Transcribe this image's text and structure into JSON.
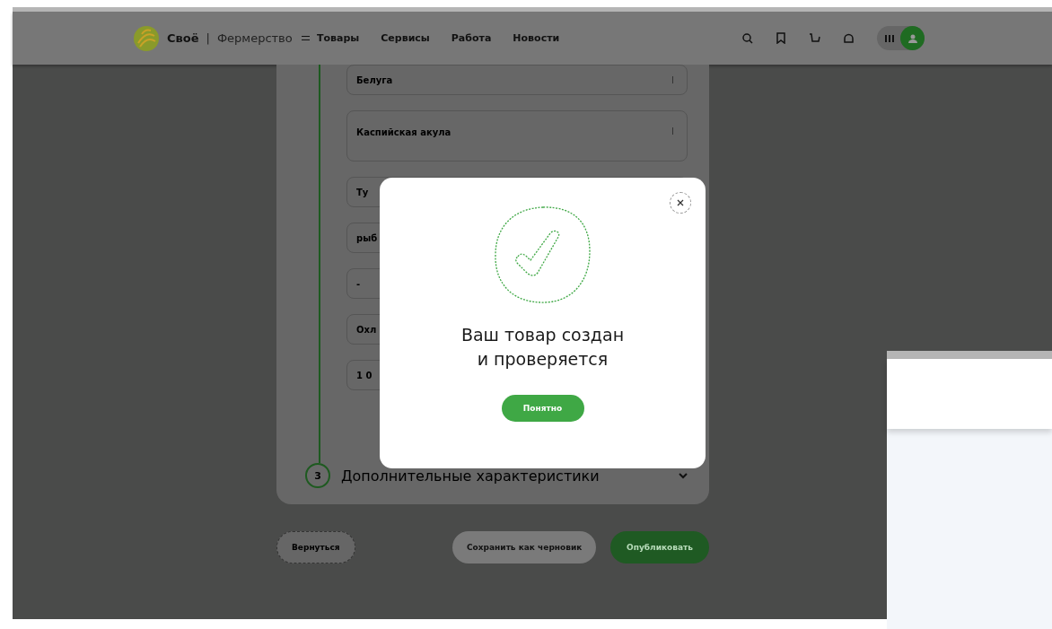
{
  "header": {
    "logo_name": "Своё",
    "logo_separator": "|",
    "logo_title": "Фермерство",
    "nav": [
      {
        "label": "Товары",
        "kind": "menu"
      },
      {
        "label": "Сервисы",
        "kind": "link"
      },
      {
        "label": "Работа",
        "kind": "link"
      },
      {
        "label": "Новости",
        "kind": "link"
      }
    ]
  },
  "form": {
    "fields": [
      {
        "value": "Белуга",
        "kind": "select"
      },
      {
        "value": "Каспийская акула",
        "kind": "textarea"
      },
      {
        "value": "Ту",
        "kind": "select"
      },
      {
        "value": "рыб",
        "kind": "select"
      },
      {
        "value": "-",
        "kind": "select"
      },
      {
        "value": "Охл",
        "kind": "select"
      },
      {
        "value": "1 0",
        "kind": "select"
      }
    ],
    "step": {
      "number": "3",
      "title": "Дополнительные характеристики",
      "expanded": false
    }
  },
  "actions": [
    {
      "label": "Вернуться",
      "kind": "outline"
    },
    {
      "label": "Сохранить как черновик",
      "kind": "muted"
    },
    {
      "label": "Опубликовать",
      "kind": "primary"
    }
  ],
  "modal": {
    "title_lines": [
      "Ваш товар создан",
      "и проверяется"
    ],
    "button": "Понятно"
  }
}
